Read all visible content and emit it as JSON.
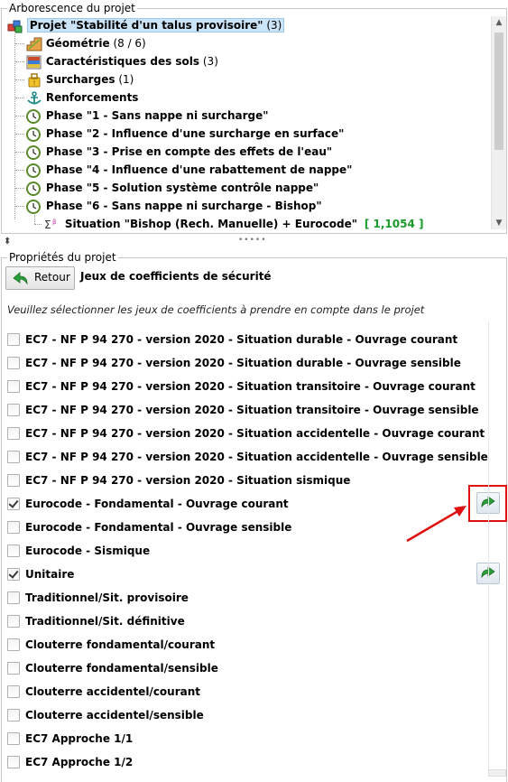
{
  "tree": {
    "title": "Arborescence du projet",
    "project_label": "Projet \"Stabilité d'un talus provisoire\"",
    "project_count": "(3)",
    "items": [
      {
        "label": "Géométrie",
        "suffix": "(8 / 6)"
      },
      {
        "label": "Caractéristiques des sols",
        "suffix": "(3)"
      },
      {
        "label": "Surcharges",
        "suffix": "(1)"
      },
      {
        "label": "Renforcements",
        "suffix": ""
      }
    ],
    "phases": [
      "Phase \"1 - Sans nappe ni surcharge\"",
      "Phase \"2 - Influence d'une surcharge en surface\"",
      "Phase \"3 - Prise en compte des effets de l'eau\"",
      "Phase \"4 - Influence d'une rabattement de nappe\"",
      "Phase \"5 - Solution système contrôle nappe\"",
      "Phase \"6 - Sans nappe ni surcharge - Bishop\""
    ],
    "situation_label": "Situation \"Bishop (Rech. Manuelle) + Eurocode\"",
    "situation_value": "[ 1,1054 ]"
  },
  "splitter_glyph": "⬍",
  "splitter_dots": "•••••",
  "properties": {
    "title": "Propriétés du projet",
    "back_label": "Retour",
    "section_title": "Jeux de coefficients de sécurité",
    "instruction": "Veuillez sélectionner les jeux de coefficients à prendre en compte dans le projet",
    "sets": [
      {
        "label": "EC7 - NF P 94 270 - version 2020 - Situation durable - Ouvrage courant",
        "checked": false
      },
      {
        "label": "EC7 - NF P 94 270 - version 2020 - Situation durable - Ouvrage sensible",
        "checked": false
      },
      {
        "label": "EC7 - NF P 94 270 - version 2020 - Situation transitoire - Ouvrage courant",
        "checked": false
      },
      {
        "label": "EC7 - NF P 94 270 - version 2020 - Situation transitoire - Ouvrage sensible",
        "checked": false
      },
      {
        "label": "EC7 - NF P 94 270 - version 2020 - Situation accidentelle - Ouvrage courant",
        "checked": false
      },
      {
        "label": "EC7 - NF P 94 270 - version 2020 - Situation accidentelle - Ouvrage sensible",
        "checked": false
      },
      {
        "label": "EC7 - NF P 94 270 - version 2020 - Situation sismique",
        "checked": false
      },
      {
        "label": "Eurocode - Fondamental - Ouvrage courant",
        "checked": true
      },
      {
        "label": "Eurocode - Fondamental - Ouvrage sensible",
        "checked": false
      },
      {
        "label": "Eurocode - Sismique",
        "checked": false
      },
      {
        "label": "Unitaire",
        "checked": true
      },
      {
        "label": "Traditionnel/Sit. provisoire",
        "checked": false
      },
      {
        "label": "Traditionnel/Sit. définitive",
        "checked": false
      },
      {
        "label": "Clouterre fondamental/courant",
        "checked": false
      },
      {
        "label": "Clouterre fondamental/sensible",
        "checked": false
      },
      {
        "label": "Clouterre accidentel/courant",
        "checked": false
      },
      {
        "label": "Clouterre accidentel/sensible",
        "checked": false
      },
      {
        "label": "EC7 Approche 1/1",
        "checked": false
      },
      {
        "label": "EC7 Approche 1/2",
        "checked": false
      }
    ]
  },
  "colors": {
    "accent_green": "#1a9a2a",
    "highlight_red": "#e01010",
    "selection": "#cce4f7"
  }
}
